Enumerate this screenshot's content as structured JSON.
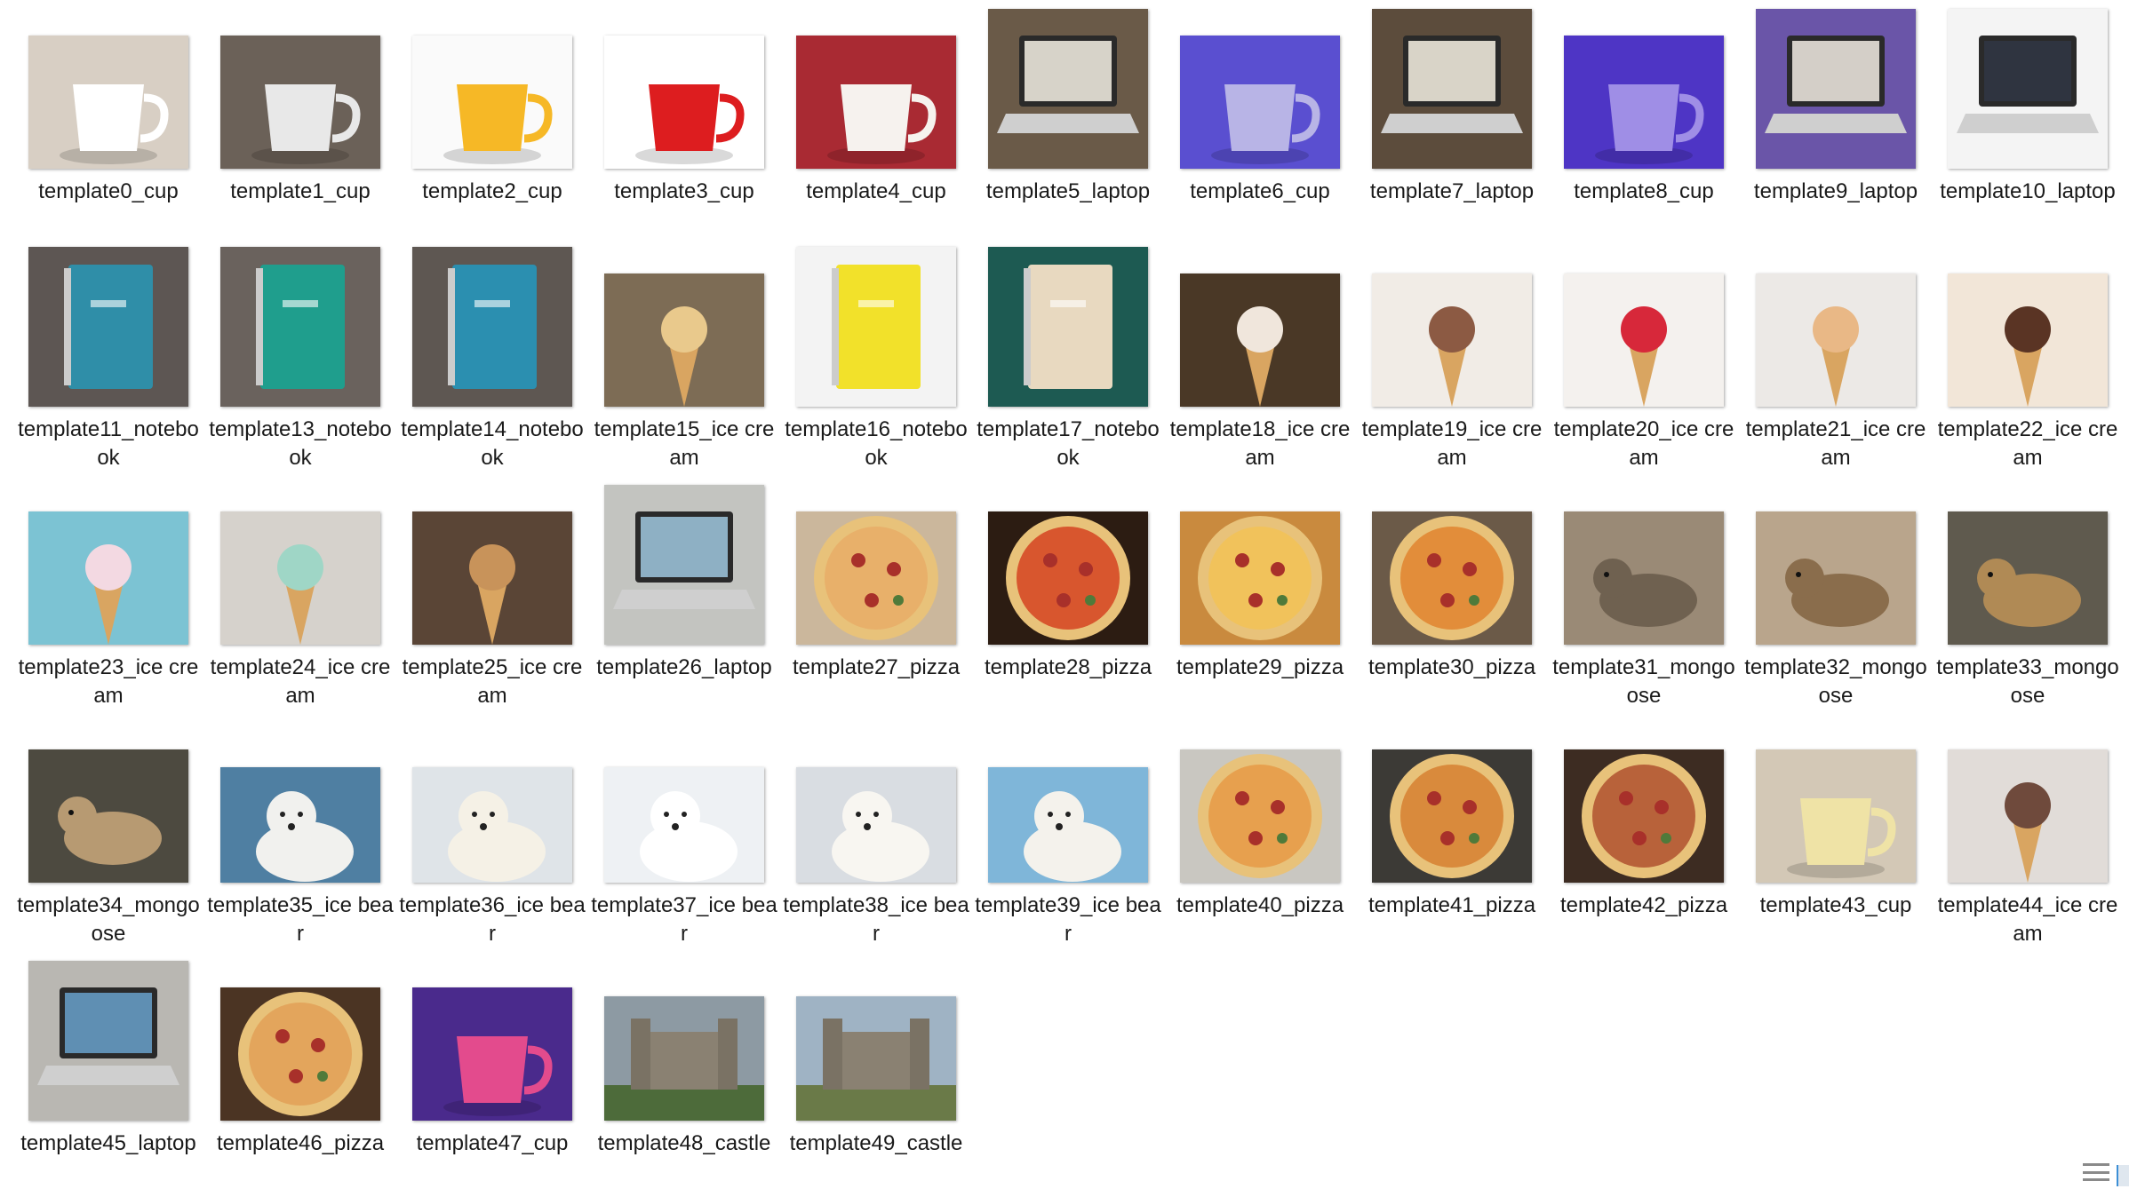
{
  "items": [
    {
      "label": "template0_cup",
      "icon": "cup",
      "colors": [
        "#d8cfc4",
        "#ffffff"
      ]
    },
    {
      "label": "template1_cup",
      "icon": "cup",
      "colors": [
        "#6b6158",
        "#e8e8e8"
      ]
    },
    {
      "label": "template2_cup",
      "icon": "cup",
      "colors": [
        "#fafafa",
        "#f6b826"
      ]
    },
    {
      "label": "template3_cup",
      "icon": "cup",
      "colors": [
        "#ffffff",
        "#dd1d1f"
      ]
    },
    {
      "label": "template4_cup",
      "icon": "cup",
      "colors": [
        "#a92a33",
        "#f6f2ee"
      ]
    },
    {
      "label": "template5_laptop",
      "icon": "laptop",
      "colors": [
        "#6a5a48",
        "#d7d3c9"
      ]
    },
    {
      "label": "template6_cup",
      "icon": "cup",
      "colors": [
        "#5a4fd0",
        "#b8b4e6"
      ]
    },
    {
      "label": "template7_laptop",
      "icon": "laptop",
      "colors": [
        "#5c4c3c",
        "#d9d4c8"
      ]
    },
    {
      "label": "template8_cup",
      "icon": "cup",
      "colors": [
        "#4e35c5",
        "#9f8ee6"
      ]
    },
    {
      "label": "template9_laptop",
      "icon": "laptop",
      "colors": [
        "#6a55a8",
        "#d4cfc8"
      ]
    },
    {
      "label": "template10_laptop",
      "icon": "laptop",
      "colors": [
        "#f4f4f4",
        "#2f3440"
      ]
    },
    {
      "label": "template11_notebook",
      "icon": "notebook",
      "colors": [
        "#5d5653",
        "#2f8ea8"
      ]
    },
    {
      "label": "template13_notebook",
      "icon": "notebook",
      "colors": [
        "#6a625d",
        "#1f9e8d"
      ]
    },
    {
      "label": "template14_notebook",
      "icon": "notebook",
      "colors": [
        "#5e5752",
        "#2b8fb0"
      ]
    },
    {
      "label": "template15_ice cream",
      "icon": "icecream",
      "colors": [
        "#7d6c55",
        "#e9c98c"
      ]
    },
    {
      "label": "template16_notebook",
      "icon": "notebook",
      "colors": [
        "#f3f3f3",
        "#f2e12a"
      ]
    },
    {
      "label": "template17_notebook",
      "icon": "notebook",
      "colors": [
        "#1d5a52",
        "#e8d9c0"
      ]
    },
    {
      "label": "template18_ice cream",
      "icon": "icecream",
      "colors": [
        "#4a3826",
        "#f0e6dc"
      ]
    },
    {
      "label": "template19_ice cream",
      "icon": "icecream",
      "colors": [
        "#f1ece6",
        "#8c5a43"
      ]
    },
    {
      "label": "template20_ice cream",
      "icon": "icecream",
      "colors": [
        "#f4f1ee",
        "#d7283a"
      ]
    },
    {
      "label": "template21_ice cream",
      "icon": "icecream",
      "colors": [
        "#ece9e6",
        "#e9b886"
      ]
    },
    {
      "label": "template22_ice cream",
      "icon": "icecream",
      "colors": [
        "#f2e6d8",
        "#5a3424"
      ]
    },
    {
      "label": "template23_ice cream",
      "icon": "icecream",
      "colors": [
        "#7cc3d3",
        "#f3d9e2"
      ]
    },
    {
      "label": "template24_ice cream",
      "icon": "icecream",
      "colors": [
        "#d6d2cc",
        "#9fd6c6"
      ]
    },
    {
      "label": "template25_ice cream",
      "icon": "icecream",
      "colors": [
        "#5a4536",
        "#c8935a"
      ]
    },
    {
      "label": "template26_laptop",
      "icon": "laptop",
      "colors": [
        "#c3c4c0",
        "#8eb0c4"
      ]
    },
    {
      "label": "template27_pizza",
      "icon": "pizza",
      "colors": [
        "#cbb79c",
        "#e8b06a"
      ]
    },
    {
      "label": "template28_pizza",
      "icon": "pizza",
      "colors": [
        "#2c1c12",
        "#d8562e"
      ]
    },
    {
      "label": "template29_pizza",
      "icon": "pizza",
      "colors": [
        "#c98a3e",
        "#f1c25b"
      ]
    },
    {
      "label": "template30_pizza",
      "icon": "pizza",
      "colors": [
        "#6b5a48",
        "#e28d3a"
      ]
    },
    {
      "label": "template31_mongoose",
      "icon": "animal",
      "colors": [
        "#9a8a76",
        "#6f6150"
      ]
    },
    {
      "label": "template32_mongoose",
      "icon": "animal",
      "colors": [
        "#b9a58c",
        "#8a6d4c"
      ]
    },
    {
      "label": "template33_mongoose",
      "icon": "animal",
      "colors": [
        "#5f5a4e",
        "#b08a55"
      ]
    },
    {
      "label": "template34_mongoose",
      "icon": "animal",
      "colors": [
        "#4d4a40",
        "#b79a72"
      ]
    },
    {
      "label": "template35_ice bear",
      "icon": "bear",
      "colors": [
        "#4f7fa2",
        "#f1f1ee"
      ]
    },
    {
      "label": "template36_ice bear",
      "icon": "bear",
      "colors": [
        "#dfe4e8",
        "#f5f1e6"
      ]
    },
    {
      "label": "template37_ice bear",
      "icon": "bear",
      "colors": [
        "#eef1f4",
        "#ffffff"
      ]
    },
    {
      "label": "template38_ice bear",
      "icon": "bear",
      "colors": [
        "#d9dde2",
        "#f8f6f1"
      ]
    },
    {
      "label": "template39_ice bear",
      "icon": "bear",
      "colors": [
        "#7fb6d9",
        "#f4f2ec"
      ]
    },
    {
      "label": "template40_pizza",
      "icon": "pizza",
      "colors": [
        "#c9c7c1",
        "#e7a04e"
      ]
    },
    {
      "label": "template41_pizza",
      "icon": "pizza",
      "colors": [
        "#3c3a36",
        "#d98a3c"
      ]
    },
    {
      "label": "template42_pizza",
      "icon": "pizza",
      "colors": [
        "#3d2c22",
        "#b8623a"
      ]
    },
    {
      "label": "template43_cup",
      "icon": "cup",
      "colors": [
        "#d3c8b6",
        "#efe3a6"
      ]
    },
    {
      "label": "template44_ice cream",
      "icon": "icecream",
      "colors": [
        "#e1dcd8",
        "#6f4a3c"
      ]
    },
    {
      "label": "template45_laptop",
      "icon": "laptop",
      "colors": [
        "#b9b7b2",
        "#5f8fb3"
      ]
    },
    {
      "label": "template46_pizza",
      "icon": "pizza",
      "colors": [
        "#4b3423",
        "#e3a55c"
      ]
    },
    {
      "label": "template47_cup",
      "icon": "cup",
      "colors": [
        "#4a2a8c",
        "#e34b8d"
      ]
    },
    {
      "label": "template48_castle",
      "icon": "castle",
      "colors": [
        "#8d9aa3",
        "#4d6b3a"
      ]
    },
    {
      "label": "template49_castle",
      "icon": "castle",
      "colors": [
        "#9fb3c4",
        "#6a7a48"
      ]
    }
  ]
}
